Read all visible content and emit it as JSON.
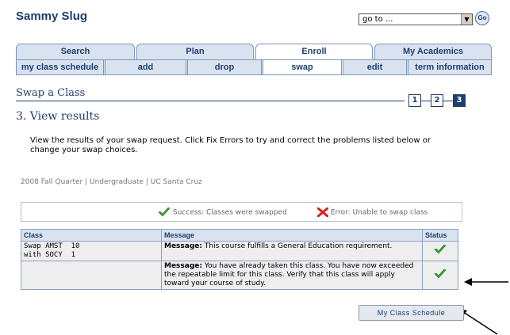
{
  "header": {
    "student_name": "Sammy Slug",
    "goto_value": "go to ...",
    "go_label": "Go"
  },
  "tabs": [
    {
      "label": "Search"
    },
    {
      "label": "Plan"
    },
    {
      "label": "Enroll"
    },
    {
      "label": "My Academics"
    }
  ],
  "subnav": [
    {
      "label": "my class schedule"
    },
    {
      "label": "add"
    },
    {
      "label": "drop"
    },
    {
      "label": "swap"
    },
    {
      "label": "edit"
    },
    {
      "label": "term information"
    }
  ],
  "page": {
    "title": "Swap a Class",
    "steps": [
      "1",
      "2",
      "3"
    ],
    "step_heading": "3.  View results",
    "instructions": "View the results of your swap request.  Click Fix Errors to try and correct the problems listed below or change your swap choices.",
    "term_info": "2008 Fall Quarter | Undergraduate | UC Santa Cruz"
  },
  "legend": {
    "success": "Success: Classes were swapped",
    "error": "Error: Unable to swap class"
  },
  "table": {
    "headers": {
      "class": "Class",
      "message": "Message",
      "status": "Status"
    },
    "rows": [
      {
        "class_line1": "Swap AMST  10",
        "class_line2": "with SOCY  1",
        "msg_label": "Message:",
        "msg_text": " This course fulfills a General Education requirement.",
        "status_icon": "success-check-icon"
      },
      {
        "class_line1": "",
        "class_line2": "",
        "msg_label": "Message:",
        "msg_text": " You have already taken this class. You have now exceeded the repeatable limit for this class. Verify that this class will apply toward your course of study.",
        "status_icon": "success-check-icon"
      }
    ]
  },
  "actions": {
    "schedule_button": "My Class Schedule"
  },
  "colors": {
    "accent": "#1f3e6e",
    "tab_bg": "#d9e3f0",
    "success": "#3aa63a",
    "error": "#d6221a"
  }
}
